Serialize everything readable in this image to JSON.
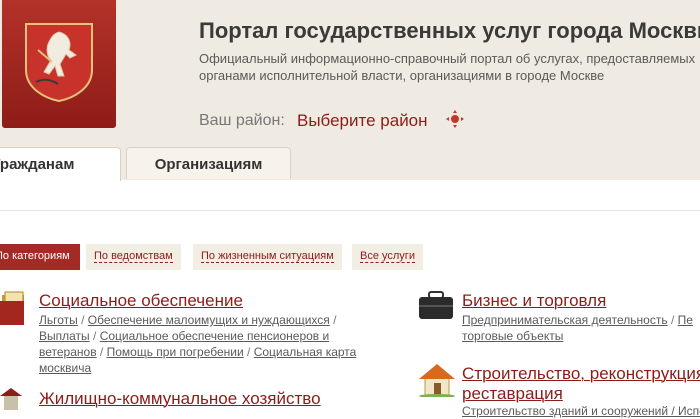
{
  "header": {
    "title": "Портал государственных услуг города Москвы",
    "subtitle_line1": "Официальный информационно-справочный портал об услугах, предоставляемых",
    "subtitle_line2": "органами исполнительной власти, организациями в городе Москве",
    "district_label": "Ваш район:",
    "district_value": "Выберите район"
  },
  "tabs": [
    {
      "label": "Гражданам"
    },
    {
      "label": "Организациям"
    }
  ],
  "filters": [
    {
      "label": "По категориям"
    },
    {
      "label": "По ведомствам"
    },
    {
      "label": "По жизненным ситуациям"
    },
    {
      "label": "Все услуги"
    }
  ],
  "categories": {
    "social": {
      "title": "Социальное обеспечение",
      "links": [
        "Льготы",
        "Обеспечение малоимущих и нуждающихся",
        "Выплаты",
        "Социальное обеспечение пенсионеров и ветеранов",
        "Помощь при погребении",
        "Социальная карта москвича"
      ]
    },
    "business": {
      "title": "Бизнес и торговля",
      "links": [
        "Предпринимательская деятельность",
        "Пе",
        "торговые объекты"
      ]
    },
    "housing": {
      "title": "Жилищно-коммунальное хозяйство"
    },
    "construction": {
      "title_line1": "Строительство, реконструкция,",
      "title_line2": "реставрация",
      "partial_links": "Строительство зданий и сооружений / Испол"
    }
  },
  "colors": {
    "accent": "#8b1c18",
    "header_bg": "#f0ebe2",
    "active_filter_bg": "#a42a26"
  },
  "icons": {
    "emblem": "moscow-coat-of-arms-icon",
    "district": "location-target-icon",
    "social": "documents-folder-icon",
    "business": "briefcase-icon",
    "housing": "house-icon"
  }
}
